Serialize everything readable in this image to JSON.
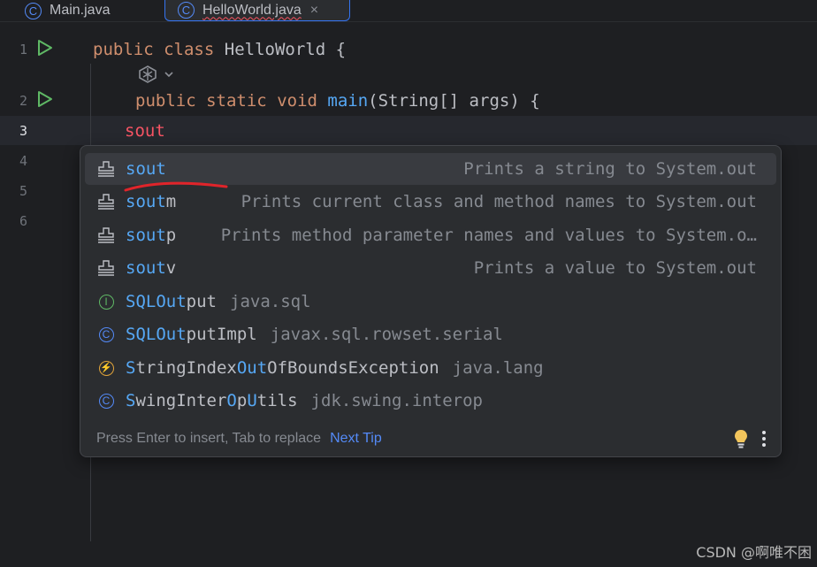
{
  "tabs": [
    {
      "label": "Main.java",
      "icon": "class-icon"
    },
    {
      "label": "HelloWorld.java",
      "icon": "class-icon",
      "active": true
    }
  ],
  "close_glyph": "×",
  "editor": {
    "line_numbers": [
      "1",
      "2",
      "3",
      "4",
      "5",
      "6"
    ],
    "line1": {
      "k1": "public",
      "k2": "class",
      "name": "HelloWorld",
      "brace": "{"
    },
    "line2": {
      "k1": "public",
      "k2": "static",
      "k3": "void",
      "method": "main",
      "params": "(String[] args) {"
    },
    "line3": {
      "typed": "sout"
    }
  },
  "completion": {
    "items": [
      {
        "name": "sout",
        "match": "sout",
        "rest": "",
        "desc": "Prints a string to System.out",
        "icon": "template-icon",
        "selected": true
      },
      {
        "name": "soutm",
        "match": "sout",
        "rest": "m",
        "desc": "Prints current class and method names to System.out",
        "icon": "template-icon"
      },
      {
        "name": "soutp",
        "match": "sout",
        "rest": "p",
        "desc": "Prints method parameter names and values to System.o…",
        "icon": "template-icon"
      },
      {
        "name": "soutv",
        "match": "sout",
        "rest": "v",
        "desc": "Prints a value to System.out",
        "icon": "template-icon"
      }
    ],
    "classes": [
      {
        "parts": [
          "S",
          "QL",
          "Out",
          "put"
        ],
        "pkg": "java.sql",
        "icon": "interface-icon"
      },
      {
        "parts": [
          "S",
          "QL",
          "Out",
          "putImpl"
        ],
        "pkg": "javax.sql.rowset.serial",
        "icon": "class-icon"
      },
      {
        "parts": [
          "S",
          "tringIndex",
          "Out",
          "OfBoundsException"
        ],
        "pkg": "java.lang",
        "icon": "exception-icon"
      },
      {
        "parts": [
          "S",
          "wingInter",
          "O",
          "p",
          "U",
          "tils"
        ],
        "pkg": "jdk.swing.interop",
        "icon": "class-icon"
      }
    ],
    "footer": {
      "hint": "Press Enter to insert, Tab to replace",
      "link": "Next Tip"
    }
  },
  "icon_glyphs": {
    "class": "C",
    "interface": "I",
    "exception": "⚡"
  },
  "watermark": "CSDN @啊唯不困",
  "colors": {
    "background": "#1e1f22",
    "popup": "#2b2d30",
    "keyword": "#cf8e6d",
    "method": "#56a8f5",
    "error": "#f75464",
    "match": "#56a8f5",
    "link": "#548af7"
  }
}
